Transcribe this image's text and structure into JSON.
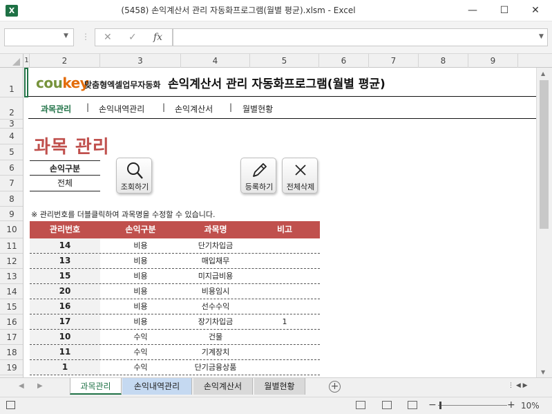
{
  "window": {
    "title": "(5458) 손익계산서 관리 자동화프로그램(월별 평균).xlsm - Excel",
    "app_icon": "X",
    "minimize": "—",
    "maximize": "☐",
    "close": "✕"
  },
  "formula_bar": {
    "name_box": "",
    "cancel": "✕",
    "enter": "✓",
    "fx": "fx",
    "value": ""
  },
  "columns": [
    "1",
    "2",
    "3",
    "4",
    "5",
    "6",
    "7",
    "8",
    "9"
  ],
  "rows": [
    "1",
    "2",
    "3",
    "4",
    "5",
    "6",
    "7",
    "8",
    "9",
    "10",
    "11",
    "12",
    "13",
    "14",
    "15",
    "16",
    "17",
    "18",
    "19"
  ],
  "header": {
    "logo_coukey": "coukey",
    "logo_sub": "맞춤형엑셀업무자동화",
    "app_title": "손익계산서 관리 자동화프로그램(월별 평균)"
  },
  "nav": {
    "items": [
      "과목관리",
      "손익내역관리",
      "손익계산서",
      "월별현황"
    ],
    "active": "과목관리",
    "separator": "|"
  },
  "page": {
    "heading": "과목 관리",
    "filter_label": "손익구분",
    "filter_value": "전체",
    "note": "※ 관리번호를 더블클릭하여 과목명을 수정할 수 있습니다."
  },
  "buttons": {
    "search": "조회하기",
    "register": "등록하기",
    "delete_all": "전체삭제"
  },
  "table": {
    "headers": [
      "관리번호",
      "손익구분",
      "과목명",
      "비고"
    ],
    "rows": [
      {
        "id": "14",
        "type": "비용",
        "name": "단기차입금",
        "note": ""
      },
      {
        "id": "13",
        "type": "비용",
        "name": "매입채무",
        "note": ""
      },
      {
        "id": "15",
        "type": "비용",
        "name": "미지급비용",
        "note": ""
      },
      {
        "id": "20",
        "type": "비용",
        "name": "비용임시",
        "note": ""
      },
      {
        "id": "16",
        "type": "비용",
        "name": "선수수익",
        "note": ""
      },
      {
        "id": "17",
        "type": "비용",
        "name": "장기차입금",
        "note": "1"
      },
      {
        "id": "10",
        "type": "수익",
        "name": "건물",
        "note": ""
      },
      {
        "id": "11",
        "type": "수익",
        "name": "기계장치",
        "note": ""
      },
      {
        "id": "1",
        "type": "수익",
        "name": "단기금융상품",
        "note": ""
      }
    ]
  },
  "sheet_tabs": [
    {
      "label": "과목관리",
      "active": true,
      "color": "#ffffff"
    },
    {
      "label": "손익내역관리",
      "active": false,
      "color": "#c5d9f1"
    },
    {
      "label": "손익계산서",
      "active": false,
      "color": "#d9d9d9"
    },
    {
      "label": "월별현황",
      "active": false,
      "color": "#d9d9d9"
    }
  ],
  "status": {
    "zoom": "10%",
    "zoom_minus": "−",
    "zoom_plus": "+"
  },
  "colors": {
    "accent_red": "#c0504d",
    "excel_green": "#217346",
    "logo_orange": "#e36c09",
    "logo_green": "#77933c",
    "nav_active": "#1e7145"
  }
}
